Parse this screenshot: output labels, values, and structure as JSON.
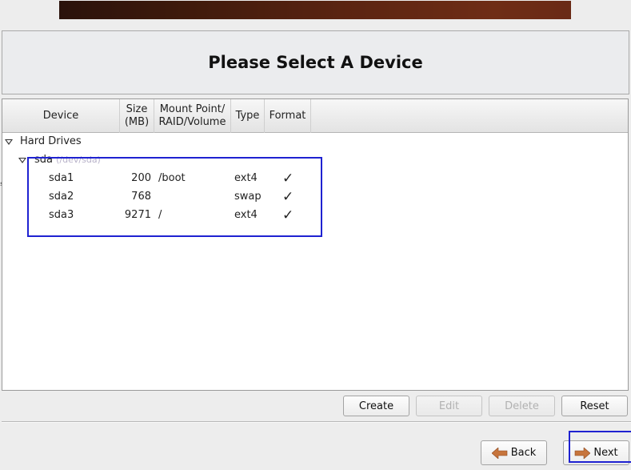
{
  "header": {
    "title": "Please Select A Device"
  },
  "columns": [
    {
      "label": "Device"
    },
    {
      "label": "Size (MB)"
    },
    {
      "label": "Mount Point/ RAID/Volume"
    },
    {
      "label": "Type"
    },
    {
      "label": "Format"
    }
  ],
  "columns_display": {
    "device": "Device",
    "size_line1": "Size",
    "size_line2": "(MB)",
    "mount_line1": "Mount Point/",
    "mount_line2": "RAID/Volume",
    "type": "Type",
    "format": "Format"
  },
  "tree": {
    "group_label": "Hard Drives",
    "disk": {
      "name": "sda",
      "path": "(/dev/sda)"
    },
    "partitions": [
      {
        "device": "sda1",
        "size": "200",
        "mount": "/boot",
        "type": "ext4",
        "format": "✓"
      },
      {
        "device": "sda2",
        "size": "768",
        "mount": "",
        "type": "swap",
        "format": "✓"
      },
      {
        "device": "sda3",
        "size": "9271",
        "mount": "/",
        "type": "ext4",
        "format": "✓"
      }
    ]
  },
  "actions": {
    "create": "Create",
    "edit": "Edit",
    "delete": "Delete",
    "reset": "Reset"
  },
  "navigation": {
    "back": "Back",
    "next": "Next"
  },
  "colors": {
    "highlight_box": "#1f22d1",
    "arrow": "#c7753d"
  }
}
